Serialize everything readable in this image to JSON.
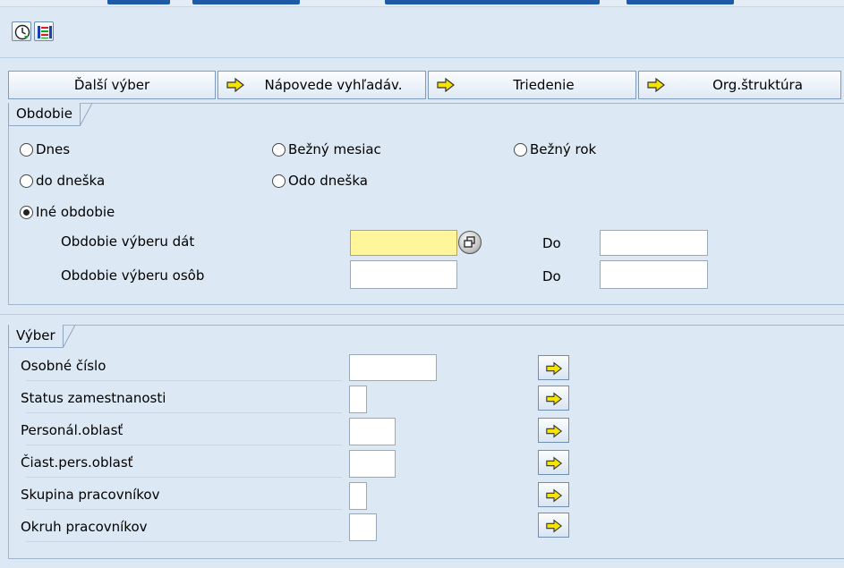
{
  "toolbar": {
    "execute_icon": "execute-clock-icon",
    "layout_icon": "layout-icon"
  },
  "selection_buttons": [
    {
      "label": "Ďalší výber",
      "icon": null
    },
    {
      "label": "Nápovede vyhľadáv.",
      "icon": "arrow-right-icon"
    },
    {
      "label": "Triedenie",
      "icon": "arrow-right-icon"
    },
    {
      "label": "Org.štruktúra",
      "icon": "arrow-right-icon"
    }
  ],
  "period": {
    "title": "Obdobie",
    "radios": [
      {
        "label": "Dnes",
        "selected": false
      },
      {
        "label": "Bežný mesiac",
        "selected": false
      },
      {
        "label": "Bežný rok",
        "selected": false
      },
      {
        "label": "do dneška",
        "selected": false
      },
      {
        "label": "Odo dneška",
        "selected": false
      },
      {
        "label": "Iné obdobie",
        "selected": true
      }
    ],
    "data_period_label": "Obdobie výberu dát",
    "person_period_label": "Obdobie výberu osôb",
    "to_label": "Do",
    "data_period_from": "",
    "data_period_to": "",
    "person_period_from": "",
    "person_period_to": ""
  },
  "selection": {
    "title": "Výber",
    "rows": [
      {
        "label": "Osobné číslo",
        "value": ""
      },
      {
        "label": "Status zamestnanosti",
        "value": ""
      },
      {
        "label": "Personál.oblasť",
        "value": ""
      },
      {
        "label": "Čiast.pers.oblasť",
        "value": ""
      },
      {
        "label": "Skupina pracovníkov",
        "value": ""
      },
      {
        "label": "Okruh pracovníkov",
        "value": ""
      }
    ]
  },
  "colors": {
    "background": "#dce8f3",
    "required_field": "#fff59a",
    "arrow_yellow": "#f5e400"
  }
}
